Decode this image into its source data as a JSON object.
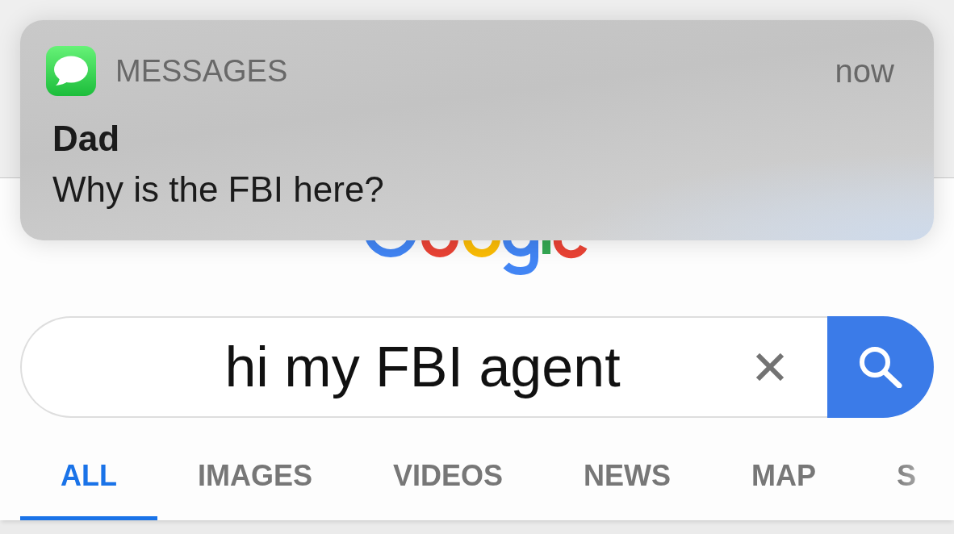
{
  "notification": {
    "app": "MESSAGES",
    "time": "now",
    "sender": "Dad",
    "message": "Why is the FBI here?"
  },
  "search": {
    "value": "hi my FBI agent"
  },
  "tabs": [
    {
      "label": "ALL",
      "selected": true
    },
    {
      "label": "IMAGES",
      "selected": false
    },
    {
      "label": "VIDEOS",
      "selected": false
    },
    {
      "label": "NEWS",
      "selected": false
    },
    {
      "label": "MAP",
      "selected": false
    },
    {
      "label": "S",
      "selected": false
    }
  ]
}
